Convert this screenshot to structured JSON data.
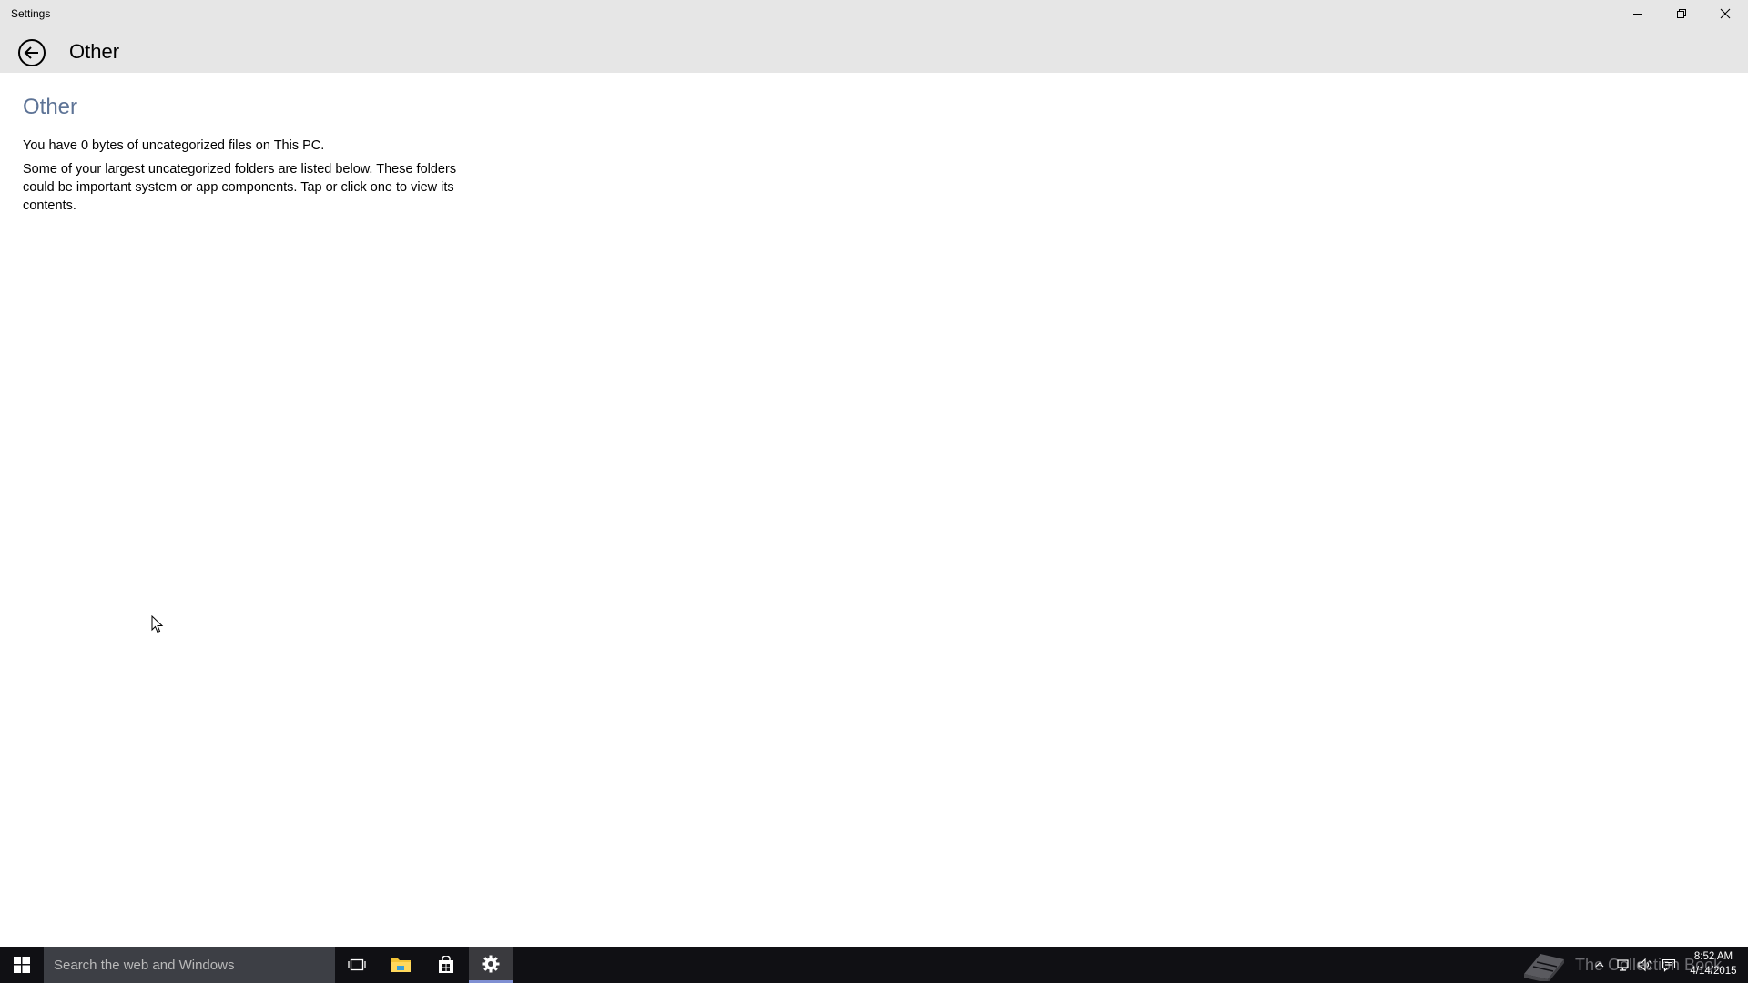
{
  "window": {
    "title": "Settings"
  },
  "header": {
    "title": "Other"
  },
  "content": {
    "section_title": "Other",
    "summary": "You have 0 bytes of uncategorized files on This PC.",
    "description": "Some of your largest uncategorized folders are listed below. These folders could be important system or app components. Tap or click one to view its contents."
  },
  "taskbar": {
    "search_placeholder": "Search the web and Windows",
    "pinned": [
      "task-view-icon",
      "file-explorer-icon",
      "store-icon",
      "settings-gear-icon"
    ],
    "watermark": "The Collection Book",
    "clock": {
      "time": "8:52 AM",
      "date": "4/14/2015"
    }
  },
  "colors": {
    "accent": "#5d7396",
    "titlebar": "#e6e6e6",
    "taskbar": "#101014",
    "active_app_indicator": "#7f8fd2"
  }
}
